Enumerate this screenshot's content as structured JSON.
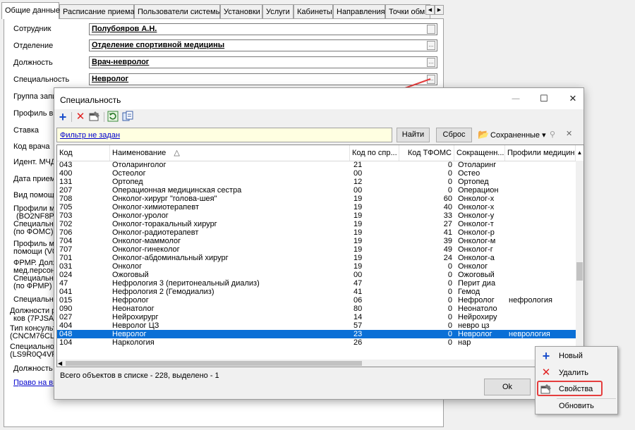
{
  "tabs": [
    "Общие данные",
    "Расписание приема",
    "Пользователи системы",
    "Установки",
    "Услуги",
    "Кабинеты",
    "Направления",
    "Точки обм"
  ],
  "form": {
    "fields": [
      {
        "label": "Сотрудник",
        "value": "Полубояров А.Н."
      },
      {
        "label": "Отделение",
        "value": "Отделение спортивной медицины"
      },
      {
        "label": "Должность",
        "value": "Врач-невролог"
      },
      {
        "label": "Специальность",
        "value": "Невролог"
      }
    ],
    "side_labels": [
      "Группа запи",
      "Профиль вра",
      "Ставка",
      "Код врача",
      "Идент. МЧД",
      "Дата приема",
      "Вид помощи",
      "Профили мед",
      "(BO2NF8PT",
      "Специально",
      "(по ФОМС)",
      "Профиль ме",
      "помощи (V00",
      "ФРМР. Долж",
      "мед.персона",
      "Специально",
      "(по ФРМР)",
      "Специально",
      "Должности р",
      "ков (7PJSAM",
      "Тип консульт",
      "(CNCM76CLK",
      "Специально",
      "(LS9R0Q4VR",
      "Должность Ф"
    ],
    "link": "Право на вы"
  },
  "dialog": {
    "title": "Специальность",
    "filter_text": "Фильтр не задан",
    "find_button": "Найти",
    "reset_button": "Сброс",
    "saved_label": "Сохраненные ▾",
    "columns": [
      "Код",
      "Наименование",
      "Код по спр...",
      "Код ТФОМС",
      "Сокращенн...",
      "Профили медицинско"
    ],
    "rows": [
      [
        "043",
        "Отоларинголог",
        "21",
        "0",
        "Отоларинг",
        ""
      ],
      [
        "400",
        "Остеолог",
        "00",
        "0",
        "Остео",
        ""
      ],
      [
        "131",
        "Ортопед",
        "12",
        "0",
        "Ортопед",
        ""
      ],
      [
        "207",
        "Операционная медицинская сестра",
        "00",
        "0",
        "Операцион",
        ""
      ],
      [
        "708",
        "Онколог-хирург \"голова-шея\"",
        "19",
        "60",
        "Онколог-х",
        ""
      ],
      [
        "705",
        "Онколог-химиотерапевт",
        "19",
        "40",
        "Онколог-х",
        ""
      ],
      [
        "703",
        "Онколог-уролог",
        "19",
        "33",
        "Онколог-у",
        ""
      ],
      [
        "702",
        "Онколог-торакальный хирург",
        "19",
        "27",
        "Онколог-т",
        ""
      ],
      [
        "706",
        "Онколог-радиотерапевт",
        "19",
        "41",
        "Онколог-р",
        ""
      ],
      [
        "704",
        "Онколог-маммолог",
        "19",
        "39",
        "Онколог-м",
        ""
      ],
      [
        "707",
        "Онколог-гинеколог",
        "19",
        "49",
        "Онколог-г",
        ""
      ],
      [
        "701",
        "Онколог-абдоминальный хирург",
        "19",
        "24",
        "Онколог-а",
        ""
      ],
      [
        "031",
        "Онколог",
        "19",
        "0",
        "Онколог",
        ""
      ],
      [
        "024",
        "Ожоговый",
        "00",
        "0",
        "Ожоговый",
        ""
      ],
      [
        "47",
        "Нефрология 3 (перитонеальный диализ)",
        "47",
        "0",
        "Перит диа",
        ""
      ],
      [
        "041",
        "Нефрология 2 (Гемодиализ)",
        "41",
        "0",
        "Гемод",
        ""
      ],
      [
        "015",
        "Нефролог",
        "06",
        "0",
        "Нефролог",
        "нефрология"
      ],
      [
        "090",
        "Неонатолог",
        "80",
        "0",
        "Неонатоло",
        ""
      ],
      [
        "027",
        "Нейрохирург",
        "14",
        "0",
        "Нейрохиру",
        ""
      ],
      [
        "404",
        "Невролог ЦЗ",
        "57",
        "0",
        "невро цз",
        ""
      ],
      [
        "048",
        "Невролог",
        "23",
        "0",
        "Невролог",
        "неврология"
      ],
      [
        "104",
        "Наркология",
        "26",
        "0",
        "нар",
        ""
      ]
    ],
    "selected_row": 20,
    "status": "Всего объектов в списке - 228, выделено - 1",
    "ok_button": "Ok"
  },
  "context_menu": {
    "items": [
      {
        "label": "Новый",
        "icon": "plus-icon"
      },
      {
        "label": "Удалить",
        "icon": "delete-x-icon"
      },
      {
        "label": "Свойства",
        "icon": "properties-icon"
      },
      {
        "label": "Обновить",
        "icon": ""
      }
    ],
    "highlighted": 2
  },
  "colors": {
    "selection": "#0a6fd6",
    "filter_bg": "#ffffe1",
    "annotation": "#e53e3e",
    "add_icon": "#1a4ecb",
    "delete_icon": "#e02020"
  }
}
